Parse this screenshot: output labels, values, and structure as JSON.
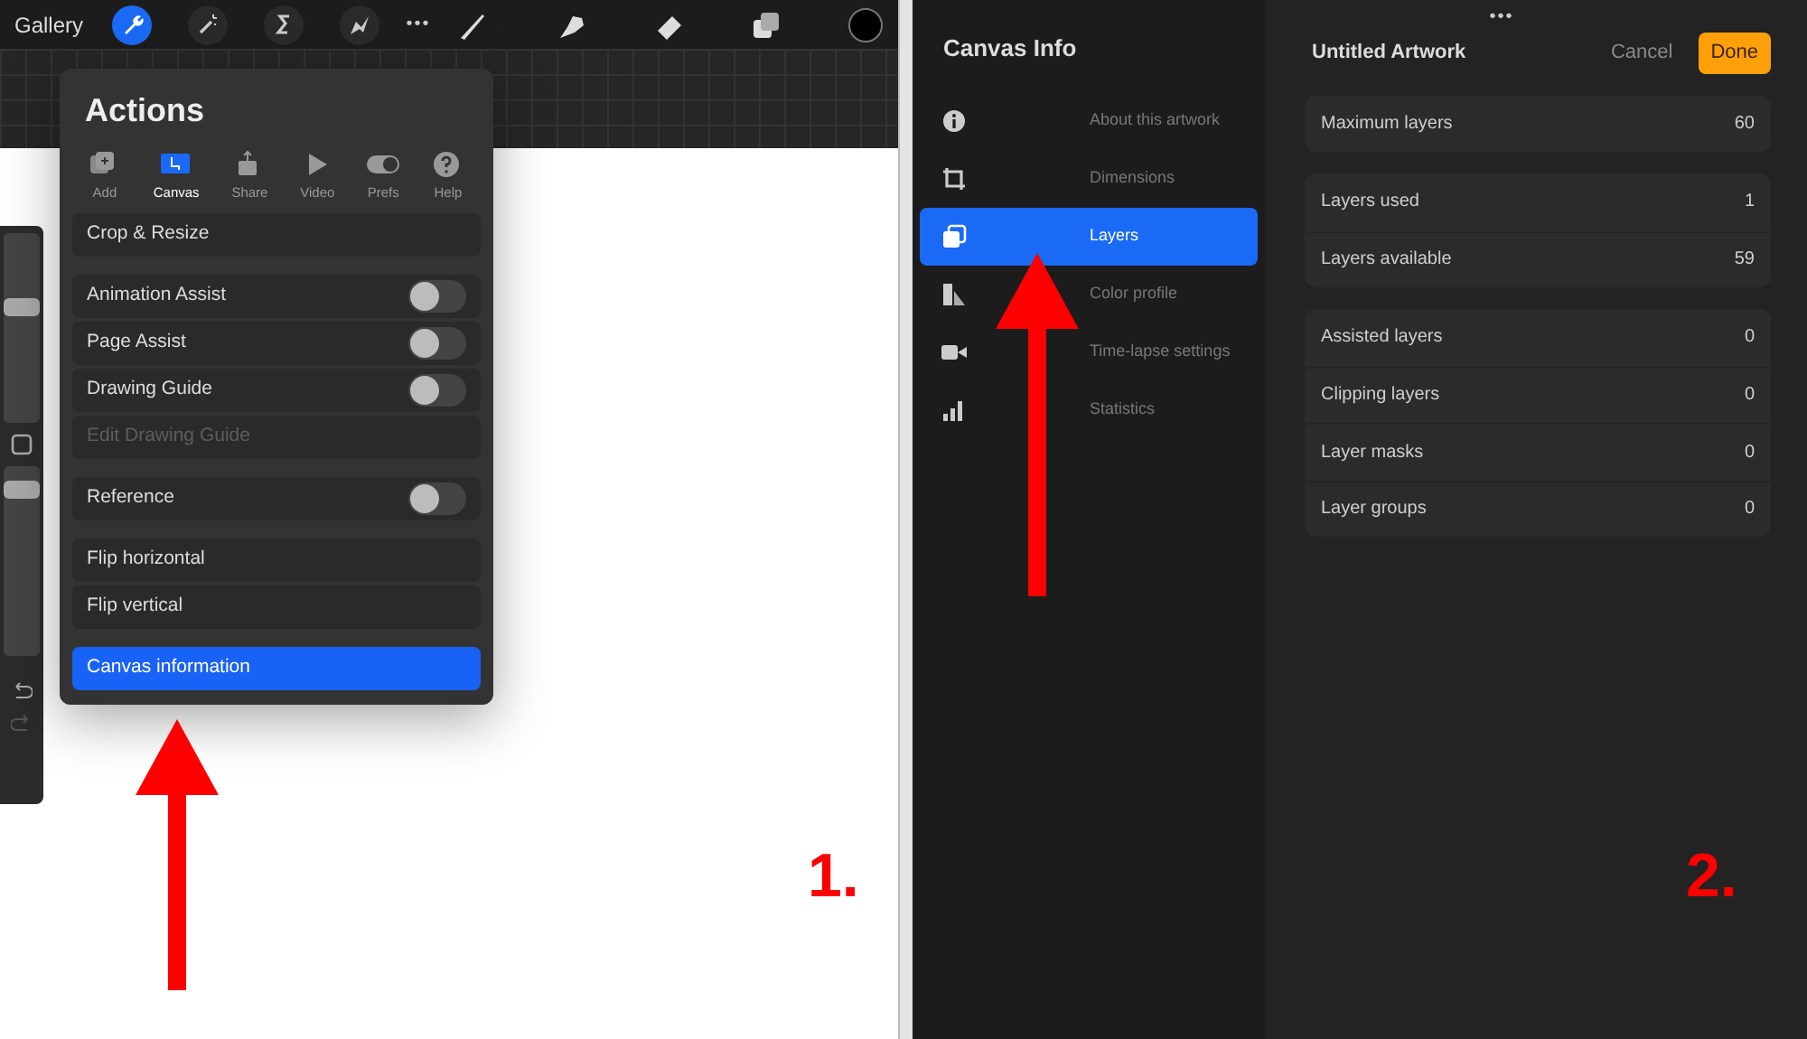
{
  "left_screen": {
    "toolbar": {
      "gallery": "Gallery",
      "more": "•••",
      "tools": [
        {
          "kind": "wrench",
          "selected": true
        },
        {
          "kind": "wand",
          "selected": false
        },
        {
          "kind": "selection",
          "selected": false
        },
        {
          "kind": "move",
          "selected": false
        }
      ],
      "paint_tools": [
        {
          "kind": "brush"
        },
        {
          "kind": "smudge"
        },
        {
          "kind": "eraser"
        },
        {
          "kind": "layers"
        }
      ]
    },
    "side_strip": {
      "sliders": [
        {
          "level": 0.62
        },
        {
          "level": 0.92
        }
      ]
    },
    "actions": {
      "title": "Actions",
      "tabs": [
        {
          "kind": "add",
          "label": "Add",
          "selected": false
        },
        {
          "kind": "canvas",
          "label": "Canvas",
          "selected": true
        },
        {
          "kind": "share",
          "label": "Share",
          "selected": false
        },
        {
          "kind": "video",
          "label": "Video",
          "selected": false
        },
        {
          "kind": "prefs",
          "label": "Prefs",
          "selected": false
        },
        {
          "kind": "help",
          "label": "Help",
          "selected": false
        }
      ],
      "groups": [
        [
          {
            "kind": "button",
            "label": "Crop & Resize"
          }
        ],
        [
          {
            "kind": "toggle",
            "label": "Animation Assist",
            "on": false
          },
          {
            "kind": "toggle",
            "label": "Page Assist",
            "on": false
          },
          {
            "kind": "toggle",
            "label": "Drawing Guide",
            "on": false
          },
          {
            "kind": "button",
            "label": "Edit Drawing Guide",
            "disabled": true
          }
        ],
        [
          {
            "kind": "toggle",
            "label": "Reference",
            "on": false
          }
        ],
        [
          {
            "kind": "button",
            "label": "Flip horizontal"
          },
          {
            "kind": "button",
            "label": "Flip vertical"
          }
        ],
        [
          {
            "kind": "primary",
            "label": "Canvas information"
          }
        ]
      ]
    },
    "annotation": "1."
  },
  "right_screen": {
    "more": "•••",
    "sidebar": {
      "title": "Canvas Info",
      "items": [
        {
          "kind": "info",
          "label": "About this artwork",
          "selected": false
        },
        {
          "kind": "dimensions",
          "label": "Dimensions",
          "selected": false
        },
        {
          "kind": "layers",
          "label": "Layers",
          "selected": true
        },
        {
          "kind": "color",
          "label": "Color profile",
          "selected": false
        },
        {
          "kind": "video",
          "label": "Time-lapse settings",
          "selected": false
        },
        {
          "kind": "stats",
          "label": "Statistics",
          "selected": false
        }
      ]
    },
    "header": {
      "title": "Untitled Artwork",
      "cancel": "Cancel",
      "done": "Done"
    },
    "groups": [
      [
        {
          "label": "Maximum layers",
          "value": "60"
        }
      ],
      [
        {
          "label": "Layers used",
          "value": "1"
        },
        {
          "label": "Layers available",
          "value": "59"
        }
      ],
      [
        {
          "label": "Assisted layers",
          "value": "0"
        },
        {
          "label": "Clipping layers",
          "value": "0"
        },
        {
          "label": "Layer masks",
          "value": "0"
        },
        {
          "label": "Layer groups",
          "value": "0"
        }
      ]
    ],
    "annotation": "2."
  }
}
